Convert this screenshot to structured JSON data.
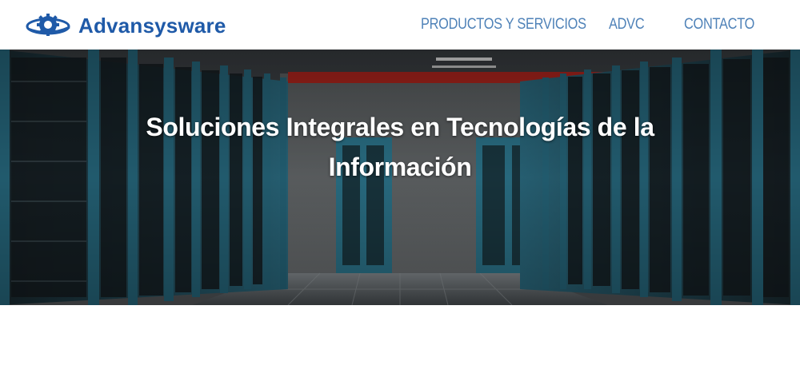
{
  "brand": {
    "name": "Advansysware"
  },
  "nav": {
    "items": [
      {
        "label": "PRODUCTOS Y SERVICIOS"
      },
      {
        "label": "ADVC"
      },
      {
        "label": "CONTACTO"
      }
    ]
  },
  "hero": {
    "title_line1": "Soluciones Integrales en Tecnologías de la",
    "title_line2": "Información",
    "background": "server-room-photo"
  },
  "colors": {
    "brand": "#1f5aa8",
    "nav": "#4f82b8",
    "rack": "#1e5b70",
    "accent_red": "#b3261e"
  }
}
